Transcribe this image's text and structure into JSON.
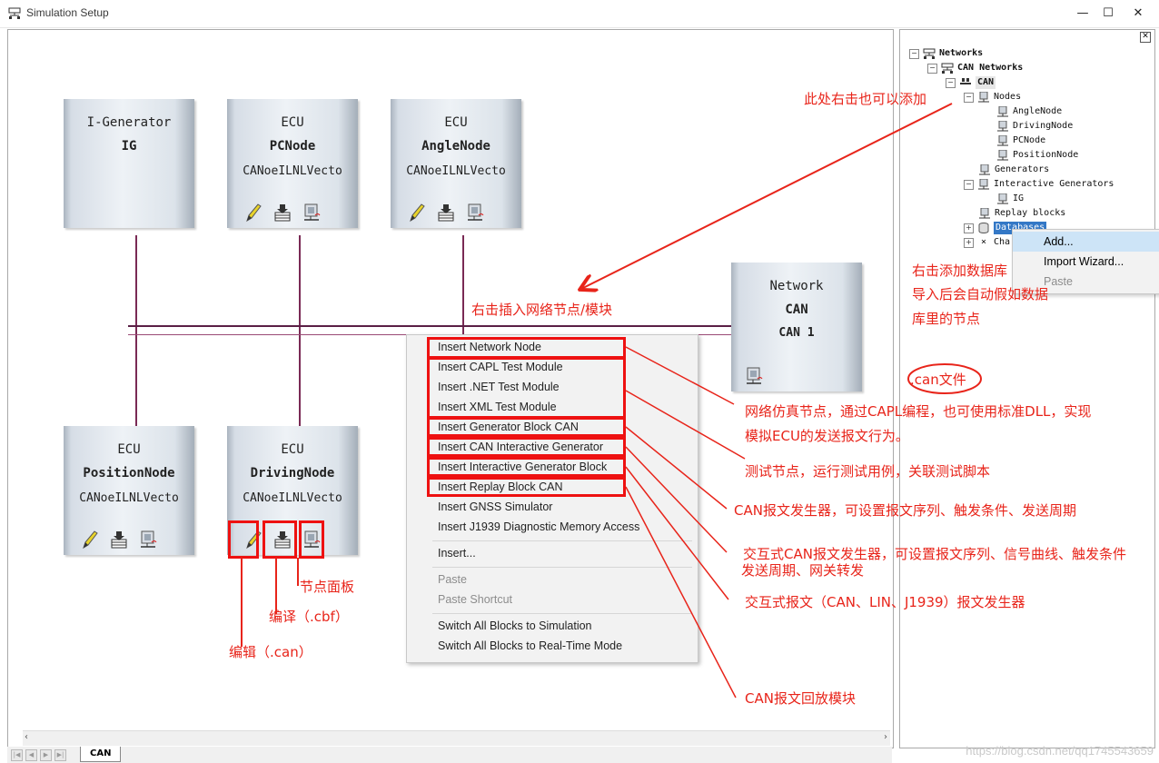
{
  "window": {
    "title": "Simulation Setup",
    "minimize": "—",
    "maximize": "☐",
    "close": "✕"
  },
  "nodes": {
    "ig": {
      "type": "I-Generator",
      "name": "IG",
      "db": ""
    },
    "pcnode": {
      "type": "ECU",
      "name": "PCNode",
      "db": "CANoeILNLVecto"
    },
    "anglenode": {
      "type": "ECU",
      "name": "AngleNode",
      "db": "CANoeILNLVecto"
    },
    "network": {
      "type": "Network",
      "name": "CAN",
      "db": "CAN 1"
    },
    "positionnode": {
      "type": "ECU",
      "name": "PositionNode",
      "db": "CANoeILNLVecto"
    },
    "drivingnode": {
      "type": "ECU",
      "name": "DrivingNode",
      "db": "CANoeILNLVecto"
    }
  },
  "context_menu": {
    "items": [
      "Insert Network Node",
      "Insert CAPL Test Module",
      "Insert .NET Test Module",
      "Insert XML Test Module",
      "Insert Generator Block CAN",
      "Insert CAN Interactive Generator",
      "Insert Interactive Generator Block",
      "Insert Replay Block CAN",
      "Insert GNSS Simulator",
      "Insert J1939 Diagnostic Memory Access",
      "Insert...",
      "Paste",
      "Paste Shortcut",
      "Switch All Blocks to Simulation",
      "Switch All Blocks to Real-Time Mode"
    ]
  },
  "tree": {
    "networks": "Networks",
    "can_networks": "CAN Networks",
    "can": "CAN",
    "nodes": "Nodes",
    "angle": "AngleNode",
    "driving": "DrivingNode",
    "pc": "PCNode",
    "position": "PositionNode",
    "generators": "Generators",
    "interactive_generators": "Interactive Generators",
    "ig": "IG",
    "replay": "Replay blocks",
    "databases": "Databases",
    "channels": "Cha"
  },
  "tree_menu": {
    "add": "Add...",
    "import": "Import Wizard...",
    "paste": "Paste"
  },
  "annotations": {
    "right_click_add": "此处右击也可以添加",
    "insert_node": "右击插入网络节点/模块",
    "add_db_1": "右击添加数据库",
    "add_db_2": "导入后会自动假如数据",
    "add_db_3": "库里的节点",
    "can_file": ".can文件",
    "network_node_1": "网络仿真节点，通过CAPL编程，也可使用标准DLL，实现",
    "network_node_2": "模拟ECU的发送报文行为。",
    "test_node": "测试节点，运行测试用例，关联测试脚本",
    "gen_block": "CAN报文发生器，可设置报文序列、触发条件、发送周期",
    "interactive_gen_1": "交互式CAN报文发生器，可设置报文序列、信号曲线、触发条件",
    "interactive_gen_2": "发送周期、网关转发",
    "interactive_block": "交互式报文（CAN、LIN、J1939）报文发生器",
    "replay_block": "CAN报文回放模块",
    "node_panel": "节点面板",
    "compile": "编译（.cbf）",
    "edit": "编辑（.can）"
  },
  "tab": {
    "label": "CAN"
  },
  "watermark": "https://blog.csdn.net/qq1745543659",
  "colors": {
    "annotation": "#e8241a",
    "bus": "#5a1f45",
    "selection": "#3478c6"
  }
}
